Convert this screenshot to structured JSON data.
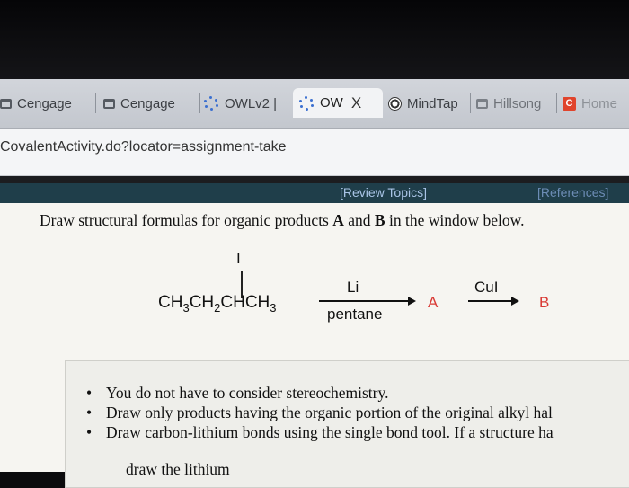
{
  "tabs": [
    {
      "label": "Cengage",
      "icon": "window-icon"
    },
    {
      "label": "Cengage",
      "icon": "window-icon"
    },
    {
      "label": "OWLv2 |",
      "icon": "spinner-icon"
    },
    {
      "label": "OW",
      "icon": "spinner-icon",
      "active": true
    },
    {
      "label": "MindTap",
      "icon": "soccer-ball-icon"
    },
    {
      "label": "Hillsong",
      "icon": "window-icon"
    },
    {
      "label": "Home",
      "icon": "c-logo-icon"
    }
  ],
  "tab_close": "X",
  "address": {
    "url": "CovalentActivity.do?locator=assignment-take"
  },
  "owl_bar": {
    "review_topics": "[Review Topics]",
    "references": "[References]"
  },
  "question": {
    "part1": "Draw structural formulas for organic products ",
    "a": "A",
    "and": " and ",
    "b": "B",
    "part2": " in the window below."
  },
  "scheme": {
    "reactant": {
      "p1": "CH",
      "s1": "3",
      "p2": "CH",
      "s2": "2",
      "p3": "CHCH",
      "s3": "3"
    },
    "substituent": "I",
    "step1": {
      "above": "Li",
      "below": "pentane",
      "product": "A"
    },
    "step2": {
      "above": "CuI",
      "product": "B"
    }
  },
  "instructions": [
    "You do not have to consider stereochemistry.",
    "Draw only products having the organic portion of the original alkyl hal",
    "Draw carbon-lithium bonds using the single bond tool. If a structure ha"
  ],
  "instruction_cont": "draw the lithium",
  "colors": {
    "product": "#d93a35",
    "owl_bar": "#1f3e4a",
    "link": "#a9c4e6"
  }
}
